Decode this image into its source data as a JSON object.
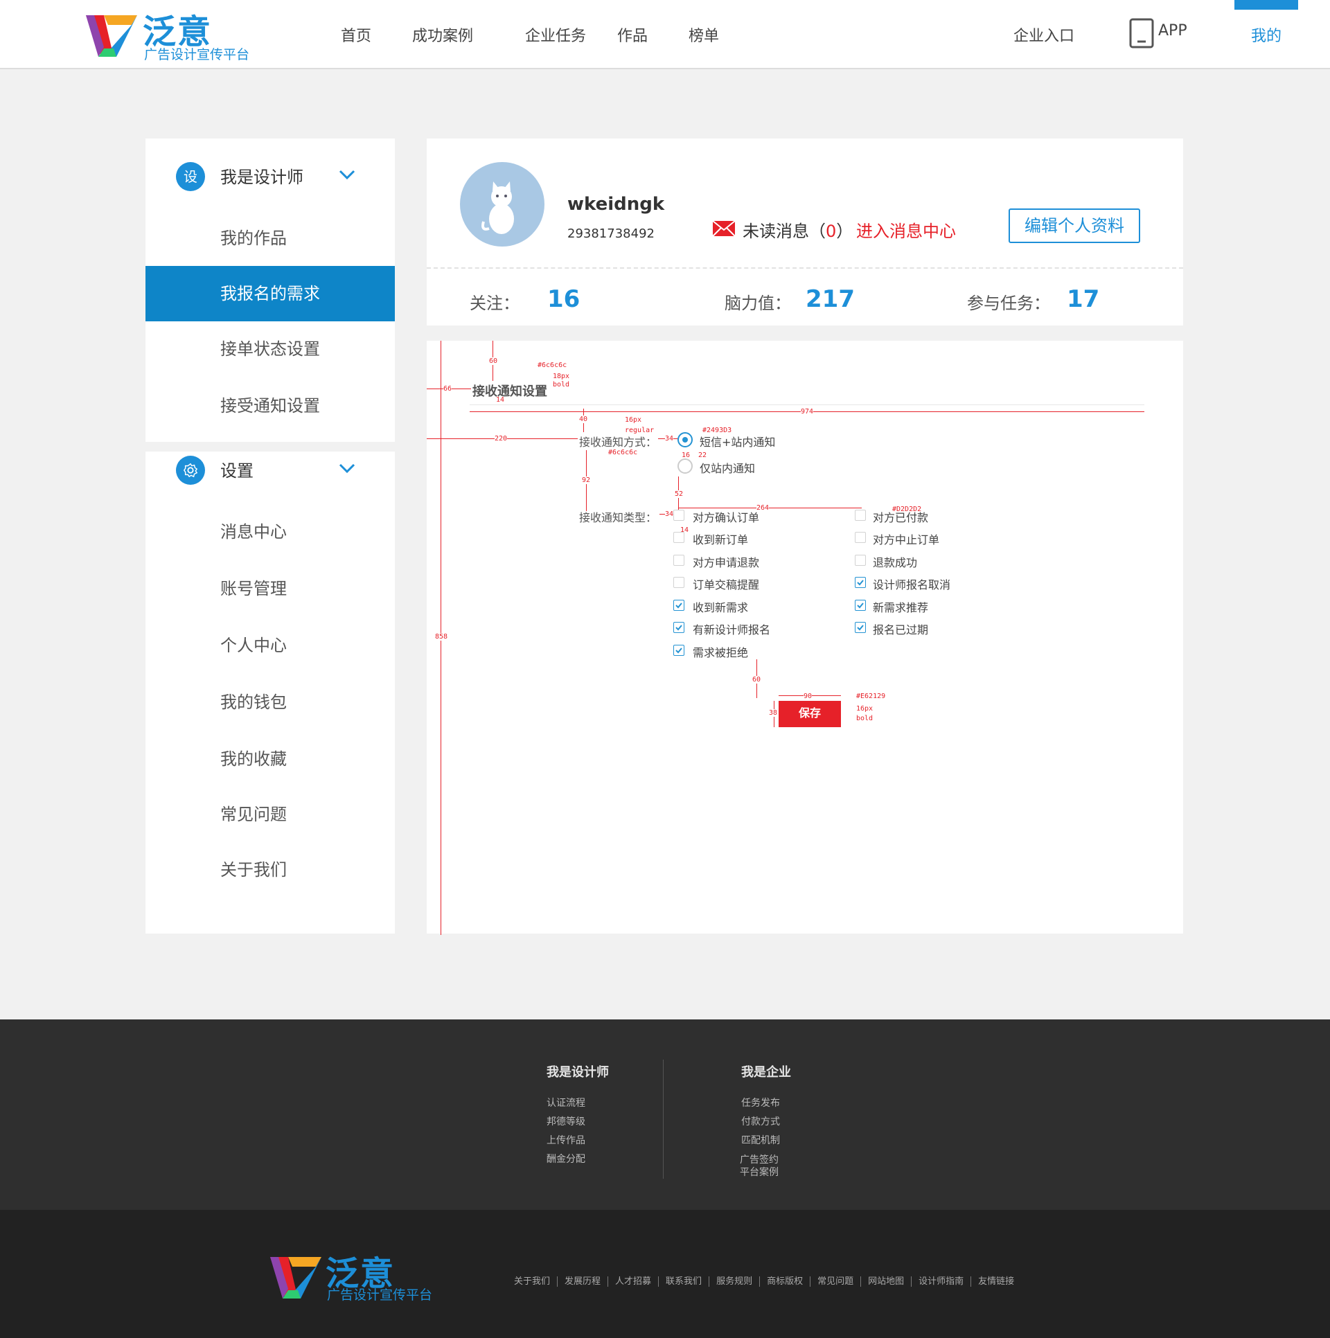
{
  "header": {
    "logo_name": "泛意",
    "logo_sub": "广告设计宣传平台",
    "nav": [
      "首页",
      "成功案例",
      "企业任务",
      "作品",
      "榜单"
    ],
    "enterprise_entry": "企业入口",
    "app_label": "APP",
    "mine_label": "我的"
  },
  "sidebar": {
    "designer_group": {
      "icon_text": "设",
      "label": "我是设计师"
    },
    "designer_items": [
      "我的作品",
      "我报名的需求",
      "接单状态设置",
      "接受通知设置"
    ],
    "active_item": "我报名的需求",
    "settings_group": {
      "icon": "gear-icon",
      "label": "设置"
    },
    "settings_items": [
      "消息中心",
      "账号管理",
      "个人中心",
      "我的钱包",
      "我的收藏",
      "常见问题",
      "关于我们"
    ]
  },
  "profile": {
    "username": "wkeidngk",
    "user_id": "29381738492",
    "unread_label": "未读消息",
    "unread_open": "（",
    "unread_count": "0",
    "unread_close": "）",
    "enter_message_center": "进入消息中心",
    "edit_button": "编辑个人资料",
    "stats": [
      {
        "label": "关注：",
        "value": "16"
      },
      {
        "label": "脑力值：",
        "value": "217"
      },
      {
        "label": "参与任务：",
        "value": "17"
      }
    ]
  },
  "notification_settings": {
    "title": "接收通知设置",
    "method_label": "接收通知方式：",
    "methods": [
      {
        "label": "短信+站内通知",
        "selected": true
      },
      {
        "label": "仅站内通知",
        "selected": false
      }
    ],
    "type_label": "接收通知类型：",
    "types_left": [
      {
        "label": "对方确认订单",
        "checked": false
      },
      {
        "label": "收到新订单",
        "checked": false
      },
      {
        "label": "对方申请退款",
        "checked": false
      },
      {
        "label": "订单交稿提醒",
        "checked": false
      },
      {
        "label": "收到新需求",
        "checked": true
      },
      {
        "label": "有新设计师报名",
        "checked": true
      },
      {
        "label": "需求被拒绝",
        "checked": true
      }
    ],
    "types_right": [
      {
        "label": "对方已付款",
        "checked": false
      },
      {
        "label": "对方中止订单",
        "checked": false
      },
      {
        "label": "退款成功",
        "checked": false
      },
      {
        "label": "设计师报名取消",
        "checked": true
      },
      {
        "label": "新需求推荐",
        "checked": true
      },
      {
        "label": "报名已过期",
        "checked": true
      }
    ],
    "save_button": "保存",
    "annotations": {
      "top_gap": "60",
      "left_gap": "66",
      "title_color": "#6c6c6c",
      "title_size": "18px",
      "title_weight": "bold",
      "title_gap": "14",
      "line_width": "974",
      "method_gap": "40",
      "label_size": "16px",
      "label_weight": "regular",
      "label_color": "#6c6c6c",
      "label_left": "220",
      "label_to_radio": "34",
      "radio_color": "#2493D3",
      "radio_size": "16",
      "radio_gap": "22",
      "method_to_type": "92",
      "radio_to_type": "52",
      "col_gap": "264",
      "checkbox_color": "#D2D2D2",
      "checkbox_size": "14",
      "type_to_btn": "60",
      "btn_width": "90",
      "btn_height": "38",
      "btn_color": "#E62129",
      "btn_size": "16px",
      "btn_weight": "bold",
      "panel_height": "858"
    }
  },
  "footer": {
    "designer_title": "我是设计师",
    "designer_links": [
      "认证流程",
      "邦德等级",
      "上传作品",
      "酬金分配"
    ],
    "enterprise_title": "我是企业",
    "enterprise_links": [
      "任务发布",
      "付款方式",
      "匹配机制",
      "广告签约",
      "平台案例"
    ],
    "logo_name": "泛意",
    "logo_sub": "广告设计宣传平台",
    "bottom_links": [
      "关于我们",
      "发展历程",
      "人才招募",
      "联系我们",
      "服务规则",
      "商标版权",
      "常见问题",
      "网站地图",
      "设计师指南",
      "友情链接"
    ]
  }
}
